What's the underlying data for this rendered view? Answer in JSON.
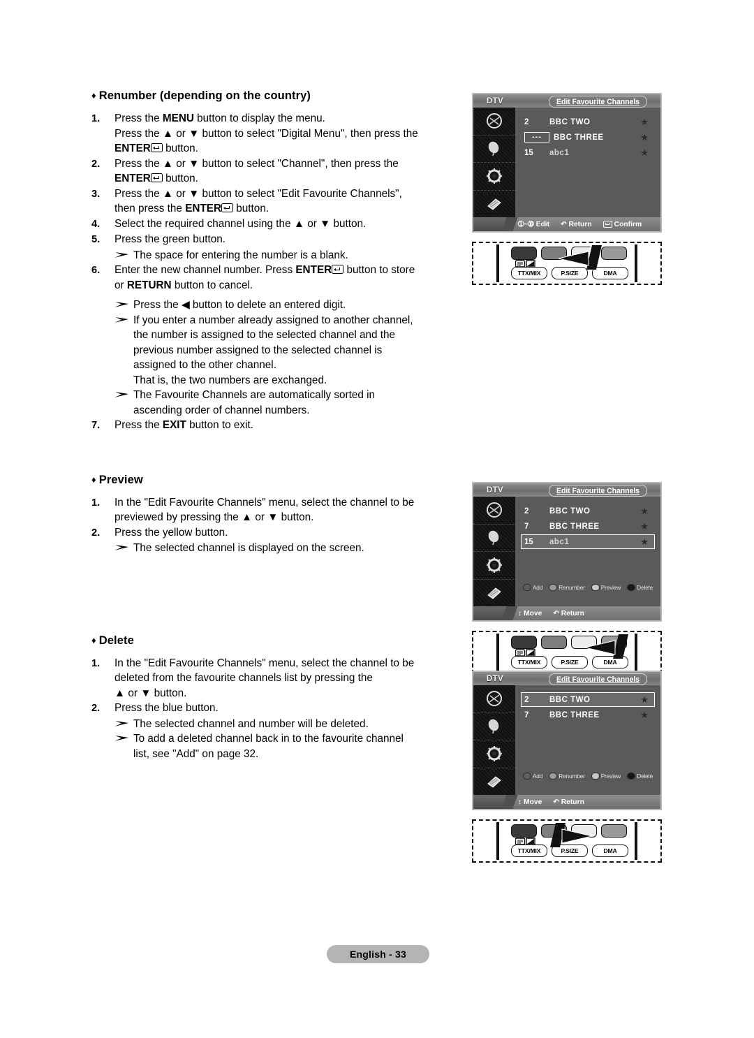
{
  "page": {
    "footer_badge": "English - 33"
  },
  "sections": [
    {
      "heading": "Renumber (depending on the country)",
      "steps": [
        {
          "num": "1.",
          "lines": [
            "Press the MENU button to display the menu.",
            "Press the ▲ or ▼ button to select \"Digital Menu\", then press the",
            "ENTER button."
          ]
        },
        {
          "num": "2.",
          "lines": [
            "Press the ▲ or ▼ button to select \"Channel\", then press the",
            "ENTER button."
          ]
        },
        {
          "num": "3.",
          "lines": [
            "Press the ▲ or ▼ button to select \"Edit Favourite Channels\",",
            "then press the ENTER button."
          ]
        },
        {
          "num": "4.",
          "lines": [
            "Select the required channel using the ▲ or ▼ button."
          ]
        },
        {
          "num": "5.",
          "lines": [
            "Press the green button."
          ]
        },
        {
          "note": "The space for entering the number is a blank."
        },
        {
          "num": "6.",
          "lines": [
            "Enter the new channel number. Press ENTER button to store",
            "or RETURN button to cancel."
          ]
        },
        {
          "note": "Press the ◀ button to delete an entered digit."
        },
        {
          "note": "If you enter a number already assigned to another channel, the number is assigned to the selected channel and the previous number assigned to the selected channel is assigned to the other channel. That is, the two numbers are exchanged."
        },
        {
          "note": "The Favourite Channels are automatically sorted in ascending order of channel numbers."
        },
        {
          "num": "7.",
          "lines": [
            "Press the EXIT button to exit."
          ]
        }
      ]
    },
    {
      "heading": "Preview",
      "steps": [
        {
          "num": "1.",
          "lines": [
            "In the \"Edit Favourite Channels\" menu, select the channel to be",
            "previewed by pressing the ▲ or ▼ button."
          ]
        },
        {
          "num": "2.",
          "lines": [
            "Press the yellow button."
          ]
        },
        {
          "note": "The selected channel is displayed on the screen."
        }
      ]
    },
    {
      "heading": "Delete",
      "steps": [
        {
          "num": "1.",
          "lines": [
            "In the \"Edit Favourite Channels\" menu, select the channel to be",
            "deleted from the favourite channels list by pressing the",
            "▲ or ▼ button."
          ]
        },
        {
          "num": "2.",
          "lines": [
            "Press the blue button."
          ]
        },
        {
          "note": "The selected channel and number will be deleted."
        },
        {
          "note": "To add a deleted channel back in to the favourite channel list, see \"Add\" on page 32."
        }
      ]
    }
  ],
  "text_fragments": {
    "menu": "MENU",
    "enter": "ENTER",
    "return": "RETURN",
    "exit": "EXIT",
    "s1_1a": "Press the ",
    "s1_1a2": " button to display the menu.",
    "s1_1b": "Press the ▲ or ▼ button to select \"Digital Menu\", then press the",
    "s1_1c": " button.",
    "s1_2a": "Press the ▲ or ▼ button to select \"Channel\", then press the",
    "s1_2b": " button.",
    "s1_3a": "Press the ▲ or ▼ button to select \"Edit Favourite Channels\",",
    "s1_3b_pre": "then press the ",
    "s1_3b_post": " button.",
    "s1_4": "Select the required channel using the ▲ or ▼ button.",
    "s1_5": "Press the green button.",
    "s1_n1": "The space for entering the number is a blank.",
    "s1_6a": "Enter the new channel number. Press ",
    "s1_6a2": " button to store",
    "s1_6b_pre": "or ",
    "s1_6b_post": " button to cancel.",
    "s1_n2": "Press the ◀ button to delete an entered digit.",
    "s1_n3l1": "If you enter a number already assigned to another channel,",
    "s1_n3l2": "the number is assigned to the selected channel and the",
    "s1_n3l3": "previous number assigned to the selected channel is",
    "s1_n3l4": "assigned to the other channel.",
    "s1_n3l5": "That is, the two numbers are exchanged.",
    "s1_n4l1": "The Favourite Channels are automatically sorted in",
    "s1_n4l2": "ascending order of channel numbers.",
    "s1_7a": "Press the ",
    "s1_7b": " button to exit.",
    "s2_1l1": "In the \"Edit Favourite Channels\" menu, select the channel to be",
    "s2_1l2": "previewed by pressing the ▲ or ▼ button.",
    "s2_2": "Press the yellow button.",
    "s2_n1": "The selected channel is displayed on the screen.",
    "s3_1l1": "In the \"Edit Favourite Channels\" menu, select the channel to be",
    "s3_1l2": "deleted from the favourite channels list by pressing the",
    "s3_1l3": "▲ or ▼ button.",
    "s3_2": "Press the blue button.",
    "s3_n1": "The selected channel and number will be deleted.",
    "s3_n2l1": "To add a deleted channel back in to the favourite channel",
    "s3_n2l2": "list, see \"Add\" on page 32.",
    "num1": "1.",
    "num2": "2.",
    "num3": "3.",
    "num4": "4.",
    "num5": "5.",
    "num6": "6.",
    "num7": "7.",
    "diamond": "♦"
  },
  "headings": {
    "renumber": "Renumber (depending on the country)",
    "preview": "Preview",
    "delete": "Delete"
  },
  "osd_screens": [
    {
      "id": "renumber",
      "source_label": "DTV",
      "title": "Edit Favourite Channels",
      "rows": [
        {
          "number": "2",
          "name": "BBC TWO",
          "favourite": "★",
          "selected": false,
          "boxed": false
        },
        {
          "number": "---",
          "name": "BBC THREE",
          "favourite": "★",
          "selected": false,
          "boxed": true
        },
        {
          "number": "15",
          "name": "abc1",
          "favourite": "★",
          "selected": false,
          "boxed": false
        }
      ],
      "legend": [],
      "footer": [
        {
          "glyph": "➀~➉",
          "label": "Edit"
        },
        {
          "glyph": "↶",
          "label": "Return"
        },
        {
          "glyph": "enter",
          "label": "Confirm"
        }
      ]
    },
    {
      "id": "preview",
      "source_label": "DTV",
      "title": "Edit Favourite Channels",
      "rows": [
        {
          "number": "2",
          "name": "BBC TWO",
          "favourite": "★",
          "selected": false,
          "boxed": false
        },
        {
          "number": "7",
          "name": "BBC THREE",
          "favourite": "★",
          "selected": false,
          "boxed": false
        },
        {
          "number": "15",
          "name": "abc1",
          "favourite": "★",
          "selected": true,
          "boxed": false
        }
      ],
      "legend": [
        {
          "color": "red",
          "label": "Add"
        },
        {
          "color": "green",
          "label": "Renumber"
        },
        {
          "color": "yellow",
          "label": "Preview"
        },
        {
          "color": "blue",
          "label": "Delete"
        }
      ],
      "footer": [
        {
          "glyph": "↕",
          "label": "Move"
        },
        {
          "glyph": "↶",
          "label": "Return"
        }
      ]
    },
    {
      "id": "delete",
      "source_label": "DTV",
      "title": "Edit Favourite Channels",
      "rows": [
        {
          "number": "2",
          "name": "BBC TWO",
          "favourite": "★",
          "selected": true,
          "boxed": false
        },
        {
          "number": "7",
          "name": "BBC THREE",
          "favourite": "★",
          "selected": false,
          "boxed": false
        }
      ],
      "legend": [
        {
          "color": "red",
          "label": "Add"
        },
        {
          "color": "green",
          "label": "Renumber"
        },
        {
          "color": "yellow",
          "label": "Preview"
        },
        {
          "color": "blue",
          "label": "Delete"
        }
      ],
      "footer": [
        {
          "glyph": "↕",
          "label": "Move"
        },
        {
          "glyph": "↶",
          "label": "Return"
        }
      ]
    }
  ],
  "remotes": [
    {
      "id": "remote-green",
      "highlight": "green",
      "buttons": [
        "TTX/MIX",
        "P.SIZE",
        "DMA"
      ]
    },
    {
      "id": "remote-yellow",
      "highlight": "yellow",
      "buttons": [
        "TTX/MIX",
        "P.SIZE",
        "DMA"
      ]
    },
    {
      "id": "remote-blue",
      "highlight": "blue",
      "buttons": [
        "TTX/MIX",
        "P.SIZE",
        "DMA"
      ]
    }
  ],
  "remote_labels": {
    "ttx": "TTX/MIX",
    "psize": "P.SIZE",
    "dma": "DMA"
  }
}
